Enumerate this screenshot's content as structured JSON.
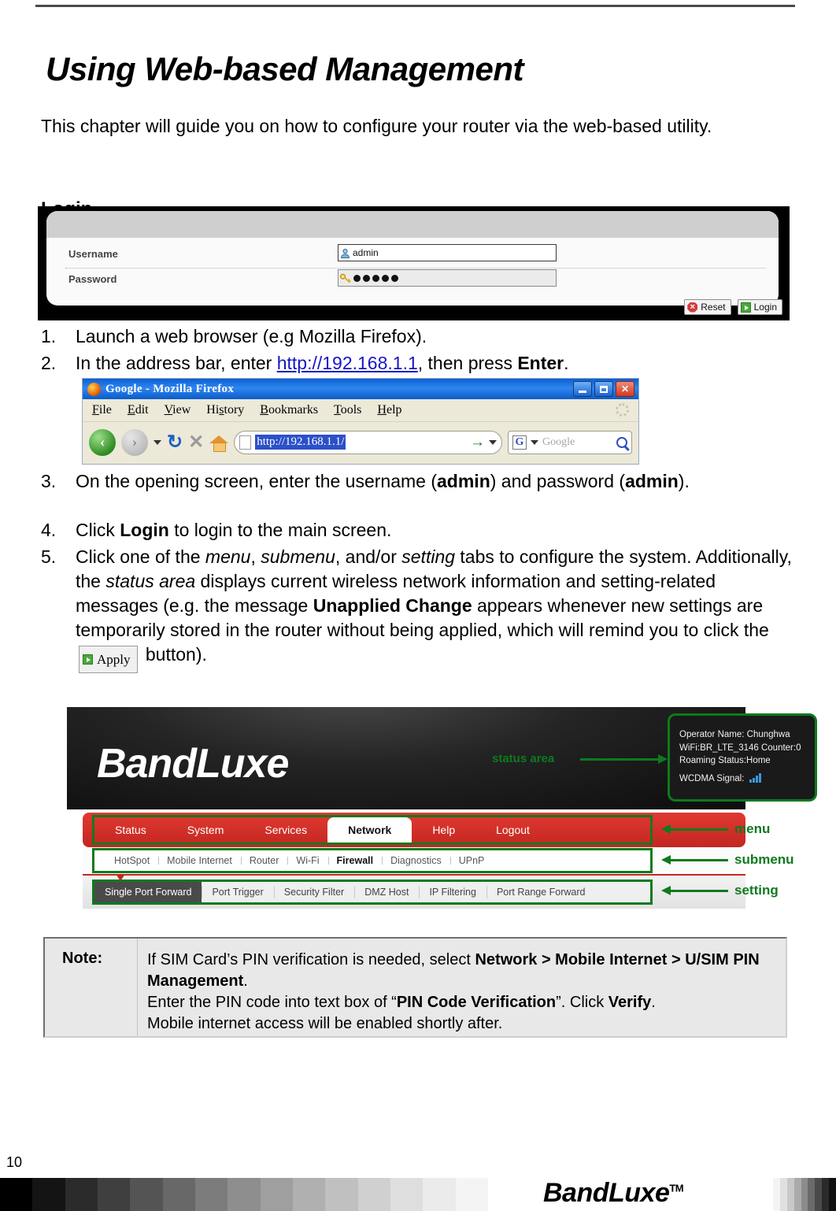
{
  "chapter": {
    "title": "Using Web-based Management",
    "intro": "This chapter will guide you on how to configure your router via the web-based utility.",
    "section_heading": "Login"
  },
  "login_screenshot": {
    "username_label": "Username",
    "username_value": "admin",
    "password_label": "Password",
    "password_value": "●●●●●",
    "reset_button": "Reset",
    "login_button": "Login"
  },
  "steps": [
    {
      "num": "1.",
      "html": "Launch a web browser (e.g Mozilla Firefox)."
    },
    {
      "num": "2.",
      "html": "In the address bar, enter <a class=\"addr\" data-name=\"router-address-link\" data-interactable=\"true\" href=\"#\">http://192.168.1.1</a>, then press <strong>Enter</strong>."
    },
    {
      "num": "3.",
      "html": "On the opening screen, enter the username (<strong>admin</strong>) and password (<strong>admin</strong>)."
    },
    {
      "num": "4.",
      "html": "Click <strong>Login</strong> to login to the main screen."
    },
    {
      "num": "5.",
      "html": "Click one of the <em>menu</em>, <em>submenu</em>, and/or <em>setting</em> tabs to configure the system. Additionally, the <em>status area</em> displays current wireless network information and setting-related messages (e.g. the message <strong>Unapplied Change</strong> appears whenever new settings are temporarily stored in the router without being applied, which will remind you to click the <span class=\"apply-inline\" data-name=\"apply-button-inline\" data-interactable=\"false\"><span class=\"ico-play\" data-name=\"play-icon\" data-interactable=\"false\"></span>Apply</span> button)."
    }
  ],
  "firefox": {
    "window_title": "Google - Mozilla Firefox",
    "menu_items": [
      "File",
      "Edit",
      "View",
      "History",
      "Bookmarks",
      "Tools",
      "Help"
    ],
    "url_value": "http://192.168.1.1/",
    "search_placeholder": "Google",
    "minimize_label": "Minimize",
    "maximize_label": "Maximize",
    "close_label": "Close"
  },
  "router_ui": {
    "brand": "BandLuxe",
    "status_area": {
      "operator": "Operator Name: Chunghwa",
      "wifi": "WiFi:BR_LTE_3146 Counter:0",
      "roaming": "Roaming Status:Home",
      "signal_label": "WCDMA Signal:"
    },
    "menu_tabs": [
      {
        "label": "Status",
        "active": false
      },
      {
        "label": "System",
        "active": false
      },
      {
        "label": "Services",
        "active": false
      },
      {
        "label": "Network",
        "active": true
      },
      {
        "label": "Help",
        "active": false
      },
      {
        "label": "Logout",
        "active": false
      }
    ],
    "submenu_tabs": [
      {
        "label": "HotSpot",
        "active": false
      },
      {
        "label": "Mobile Internet",
        "active": false
      },
      {
        "label": "Router",
        "active": false
      },
      {
        "label": "Wi-Fi",
        "active": false
      },
      {
        "label": "Firewall",
        "active": true
      },
      {
        "label": "Diagnostics",
        "active": false
      },
      {
        "label": "UPnP",
        "active": false
      }
    ],
    "setting_tabs": [
      {
        "label": "Single Port Forward",
        "active": true
      },
      {
        "label": "Port Trigger",
        "active": false
      },
      {
        "label": "Security Filter",
        "active": false
      },
      {
        "label": "DMZ Host",
        "active": false
      },
      {
        "label": "IP Filtering",
        "active": false
      },
      {
        "label": "Port Range Forward",
        "active": false
      }
    ],
    "annotations": {
      "status_area": "status area",
      "menu": "menu",
      "submenu": "submenu",
      "setting": "setting"
    },
    "accent_colors": {
      "menu_red": "#c32620",
      "annotation_green": "#0d7a1e",
      "signal_blue": "#3b97de"
    }
  },
  "note": {
    "label": "Note:",
    "html": "If SIM Card’s PIN verification is needed, select <strong>Network &gt; Mobile Internet &gt; U/SIM PIN Management</strong>.<br>Enter the PIN code into text box of “<strong>PIN Code Verification</strong>”. Click <strong>Verify</strong>.<br>Mobile internet access will be enabled shortly after."
  },
  "footer": {
    "page_number": "10",
    "logo": "BandLuxe",
    "trademark": "TM"
  }
}
